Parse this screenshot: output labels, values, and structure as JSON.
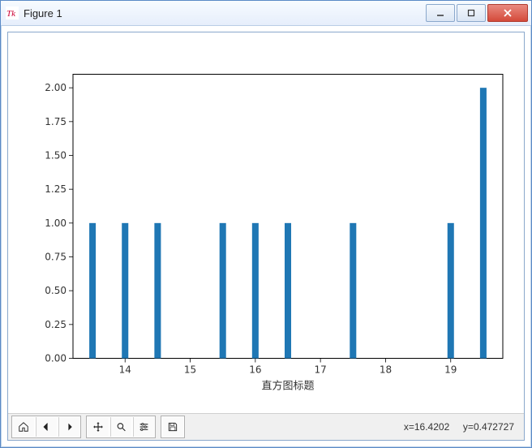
{
  "window": {
    "title": "Figure 1"
  },
  "toolbar": {
    "coords_x_label": "x=",
    "coords_x_value": "16.4202",
    "coords_y_label": "y=",
    "coords_y_value": "0.472727",
    "buttons": {
      "home": "Home",
      "back": "Back",
      "forward": "Forward",
      "pan": "Pan",
      "zoom": "Zoom",
      "configure": "Configure",
      "save": "Save"
    }
  },
  "chart_data": {
    "type": "bar",
    "title": "",
    "xlabel": "直方图标题",
    "ylabel": "",
    "xlim": [
      13.2,
      19.8
    ],
    "ylim": [
      0,
      2.1
    ],
    "x_ticks": [
      14,
      15,
      16,
      17,
      18,
      19
    ],
    "y_ticks": [
      0.0,
      0.25,
      0.5,
      0.75,
      1.0,
      1.25,
      1.5,
      1.75,
      2.0
    ],
    "categories": [
      13.5,
      14.0,
      14.5,
      15.5,
      16.0,
      16.5,
      17.5,
      19.0,
      19.5
    ],
    "values": [
      1,
      1,
      1,
      1,
      1,
      1,
      1,
      1,
      2
    ],
    "bar_color": "#1f77b4",
    "bar_width_data_units": 0.1
  }
}
